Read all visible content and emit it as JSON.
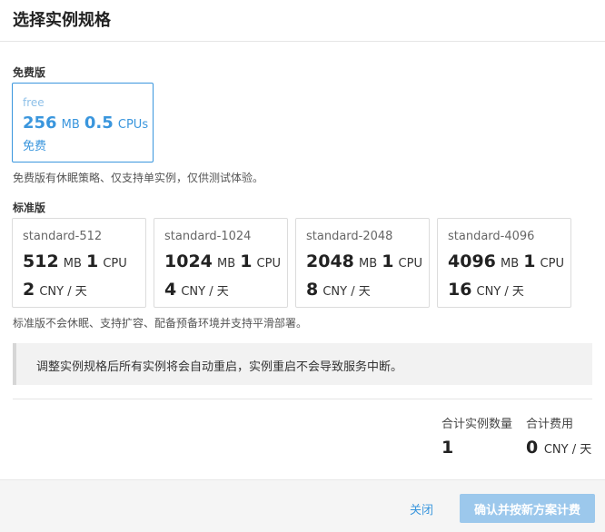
{
  "dialog": {
    "title": "选择实例规格"
  },
  "free_section": {
    "label": "免费版",
    "card": {
      "plan": "free",
      "memory": "256",
      "memory_unit": "MB",
      "cpu": "0.5",
      "cpu_unit": "CPUs",
      "price_text": "免费"
    },
    "note": "免费版有休眠策略、仅支持单实例，仅供测试体验。"
  },
  "standard_section": {
    "label": "标准版",
    "cards": [
      {
        "plan": "standard-512",
        "memory": "512",
        "memory_unit": "MB",
        "cpu": "1",
        "cpu_unit": "CPU",
        "price": "2",
        "price_unit": "CNY / 天"
      },
      {
        "plan": "standard-1024",
        "memory": "1024",
        "memory_unit": "MB",
        "cpu": "1",
        "cpu_unit": "CPU",
        "price": "4",
        "price_unit": "CNY / 天"
      },
      {
        "plan": "standard-2048",
        "memory": "2048",
        "memory_unit": "MB",
        "cpu": "1",
        "cpu_unit": "CPU",
        "price": "8",
        "price_unit": "CNY / 天"
      },
      {
        "plan": "standard-4096",
        "memory": "4096",
        "memory_unit": "MB",
        "cpu": "1",
        "cpu_unit": "CPU",
        "price": "16",
        "price_unit": "CNY / 天"
      }
    ],
    "note": "标准版不会休眠、支持扩容、配备预备环境并支持平滑部署。"
  },
  "notice": {
    "text": "调整实例规格后所有实例将会自动重启，实例重启不会导致服务中断。"
  },
  "summary": {
    "instance_count_label": "合计实例数量",
    "instance_count": "1",
    "total_cost_label": "合计费用",
    "total_cost": "0",
    "total_cost_unit": "CNY / 天"
  },
  "footer": {
    "close_label": "关闭",
    "confirm_label": "确认并按新方案计费"
  },
  "colors": {
    "accent": "#3a96dd",
    "confirm_disabled_bg": "#9cc8ec"
  }
}
